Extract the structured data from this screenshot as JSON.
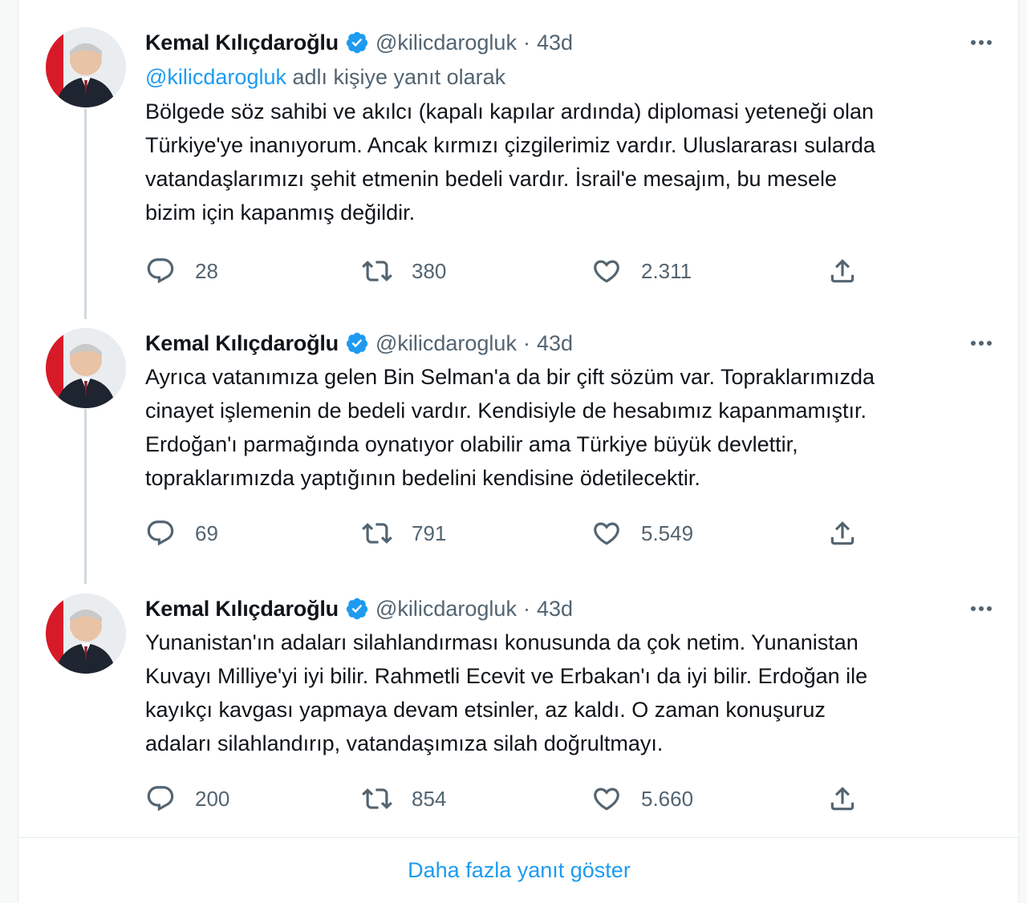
{
  "tweets": [
    {
      "author_name": "Kemal Kılıçdaroğlu",
      "handle": "@kilicdarogluk",
      "separator": "·",
      "time": "43d",
      "reply_to_mention": "@kilicdarogluk",
      "reply_to_suffix": " adlı kişiye yanıt olarak",
      "lines": [
        "Bölgede söz sahibi ve akılcı (kapalı kapılar ardında) diplomasi yeteneği olan",
        "Türkiye'ye inanıyorum. Ancak kırmızı çizgilerimiz vardır. Uluslararası sularda",
        "vatandaşlarımızı şehit etmenin bedeli vardır. İsrail'e mesajım, bu mesele",
        "bizim için kapanmış değildir."
      ],
      "replies": "28",
      "retweets": "380",
      "likes": "2.311"
    },
    {
      "author_name": "Kemal Kılıçdaroğlu",
      "handle": "@kilicdarogluk",
      "separator": "·",
      "time": "43d",
      "lines": [
        "Ayrıca vatanımıza gelen Bin Selman'a da bir çift sözüm var. Topraklarımızda",
        "cinayet işlemenin de bedeli vardır. Kendisiyle de hesabımız kapanmamıştır.",
        "Erdoğan'ı parmağında oynatıyor olabilir ama Türkiye büyük devlettir,",
        "topraklarımızda yaptığının bedelini kendisine ödetilecektir."
      ],
      "replies": "69",
      "retweets": "791",
      "likes": "5.549"
    },
    {
      "author_name": "Kemal Kılıçdaroğlu",
      "handle": "@kilicdarogluk",
      "separator": "·",
      "time": "43d",
      "lines": [
        "Yunanistan'ın adaları silahlandırması konusunda da çok netim. Yunanistan",
        "Kuvayı Milliye'yi iyi bilir. Rahmetli Ecevit ve Erbakan'ı da iyi bilir. Erdoğan ile",
        "kayıkçı kavgası yapmaya devam etsinler, az kaldı. O zaman konuşuruz",
        "adaları silahlandırıp, vatandaşımıza silah doğrultmayı."
      ],
      "replies": "200",
      "retweets": "854",
      "likes": "5.660"
    }
  ],
  "show_more_label": "Daha fazla yanıt göster",
  "colors": {
    "accent": "#1d9bf0",
    "text": "#0f1419",
    "muted": "#536471"
  },
  "icons": [
    "more-icon",
    "verified-icon",
    "reply-icon",
    "retweet-icon",
    "like-icon",
    "share-icon"
  ]
}
